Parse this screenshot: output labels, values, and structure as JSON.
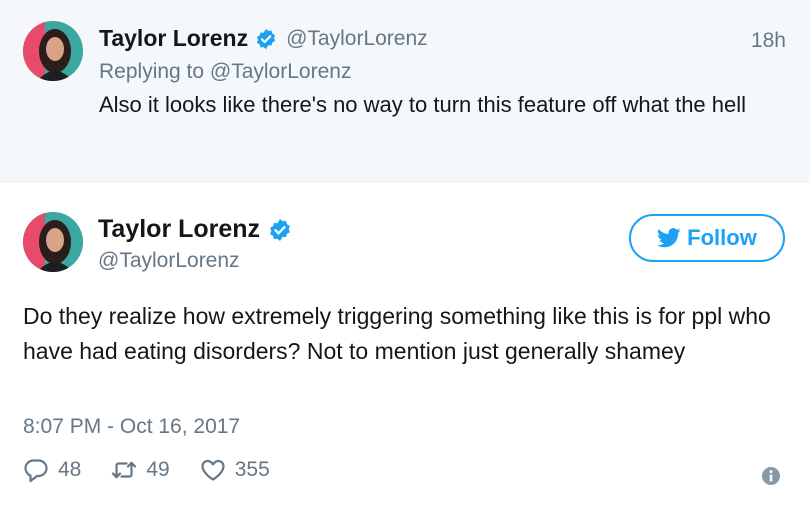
{
  "reply_tweet": {
    "author_name": "Taylor Lorenz",
    "handle": "@TaylorLorenz",
    "time_ago": "18h",
    "replying_to": "Replying to @TaylorLorenz",
    "text": "Also it looks like there's no way to turn this feature off what the hell"
  },
  "main_tweet": {
    "author_name": "Taylor Lorenz",
    "handle": "@TaylorLorenz",
    "follow_label": "Follow",
    "text": "Do they realize how extremely triggering something like this is for ppl who have had eating disorders? Not to mention just generally shamey",
    "timestamp": "8:07 PM - Oct 16, 2017",
    "reply_count": "48",
    "retweet_count": "49",
    "like_count": "355"
  },
  "icons": {
    "verified": "verified-badge-icon",
    "bird": "twitter-bird-icon",
    "reply": "reply-bubble-icon",
    "retweet": "retweet-icon",
    "like": "heart-icon",
    "info": "info-icon"
  },
  "colors": {
    "accent": "#1da1f2",
    "secondary_text": "#657786",
    "reply_background": "#f5f8fa"
  }
}
